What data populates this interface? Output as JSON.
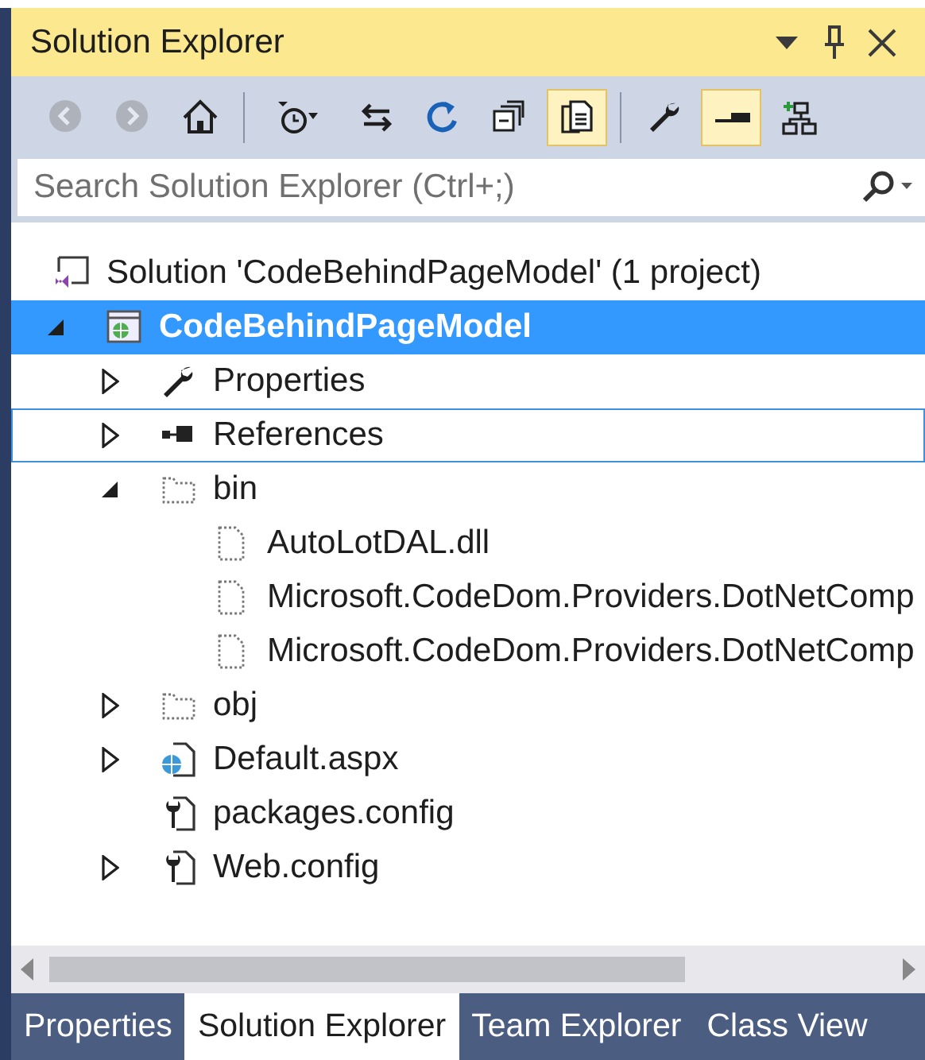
{
  "window": {
    "title": "Solution Explorer"
  },
  "toolbar": [
    {
      "kind": "back",
      "disabled": true,
      "on": false
    },
    {
      "kind": "forward",
      "disabled": true,
      "on": false
    },
    {
      "kind": "home",
      "disabled": false,
      "on": false
    },
    {
      "kind": "separator"
    },
    {
      "kind": "history",
      "disabled": false,
      "on": false
    },
    {
      "kind": "sync",
      "disabled": false,
      "on": false
    },
    {
      "kind": "refresh",
      "disabled": false,
      "on": false
    },
    {
      "kind": "collapse",
      "disabled": false,
      "on": false
    },
    {
      "kind": "show-all",
      "disabled": false,
      "on": true
    },
    {
      "kind": "separator"
    },
    {
      "kind": "properties",
      "disabled": false,
      "on": false
    },
    {
      "kind": "preview",
      "disabled": false,
      "on": true
    },
    {
      "kind": "diagram",
      "disabled": false,
      "on": false
    }
  ],
  "search": {
    "placeholder": "Search Solution Explorer (Ctrl+;)"
  },
  "tree": [
    {
      "label": "Solution 'CodeBehindPageModel' (1 project)",
      "kind": "solution",
      "selected": false,
      "focused": false,
      "children": [
        {
          "label": "CodeBehindPageModel",
          "kind": "web-project",
          "selected": true,
          "focused": false,
          "expanded": true,
          "children": [
            {
              "label": "Properties",
              "kind": "properties",
              "selected": false,
              "focused": false,
              "expanded": false
            },
            {
              "label": "References",
              "kind": "references",
              "selected": false,
              "focused": true,
              "expanded": false
            },
            {
              "label": "bin",
              "kind": "folder",
              "selected": false,
              "focused": false,
              "expanded": true,
              "children": [
                {
                  "label": "AutoLotDAL.dll",
                  "kind": "file",
                  "selected": false,
                  "focused": false
                },
                {
                  "label": "Microsoft.CodeDom.Providers.DotNetComp",
                  "kind": "file",
                  "selected": false,
                  "focused": false
                },
                {
                  "label": "Microsoft.CodeDom.Providers.DotNetComp",
                  "kind": "file",
                  "selected": false,
                  "focused": false
                }
              ]
            },
            {
              "label": "obj",
              "kind": "folder",
              "selected": false,
              "focused": false,
              "expanded": false
            },
            {
              "label": "Default.aspx",
              "kind": "web-file",
              "selected": false,
              "focused": false,
              "expanded": false
            },
            {
              "label": "packages.config",
              "kind": "config-file",
              "selected": false,
              "focused": false
            },
            {
              "label": "Web.config",
              "kind": "config-file",
              "selected": false,
              "focused": false,
              "expanded": false
            }
          ]
        }
      ]
    }
  ],
  "tabs": [
    {
      "label": "Properties",
      "selected": false
    },
    {
      "label": "Solution Explorer",
      "selected": true
    },
    {
      "label": "Team Explorer",
      "selected": false
    },
    {
      "label": "Class View",
      "selected": false
    }
  ]
}
